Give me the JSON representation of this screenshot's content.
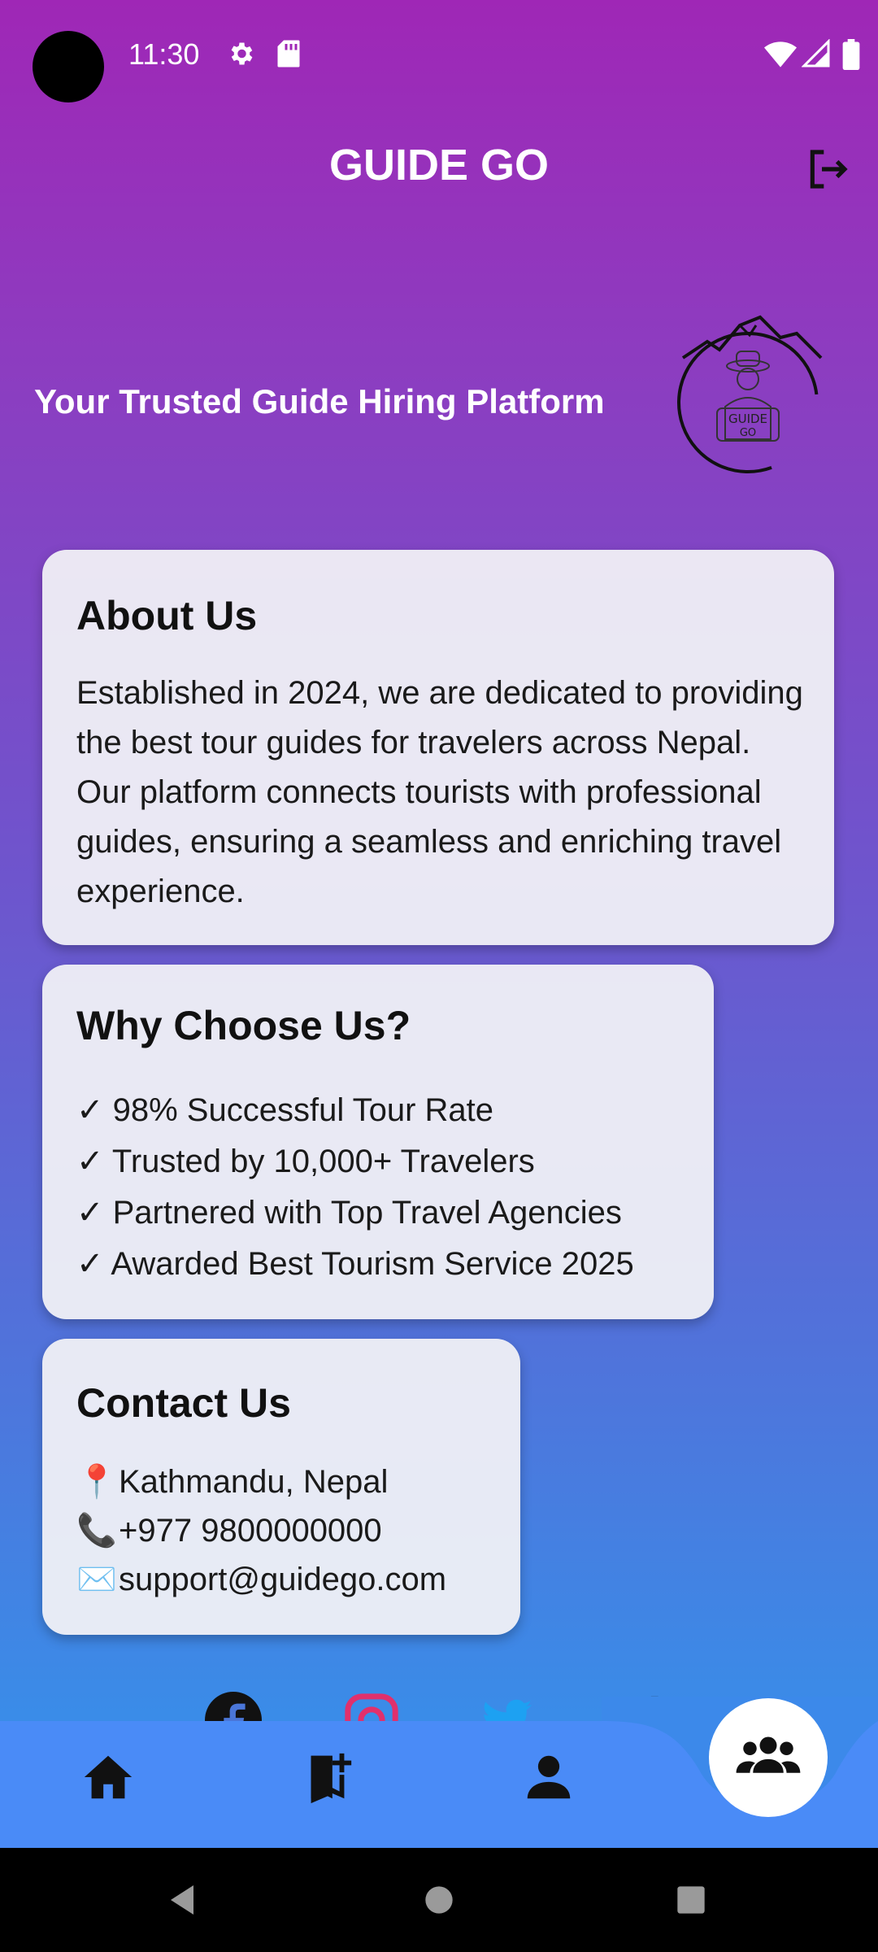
{
  "status": {
    "time": "11:30"
  },
  "header": {
    "title": "GUIDE GO"
  },
  "tagline": "Your Trusted Guide Hiring Platform",
  "logo_text": "GUIDE GO",
  "about": {
    "heading": "About Us",
    "body": "Established in 2024, we are dedicated to providing the best tour guides for travelers across Nepal. Our platform connects tourists with professional guides, ensuring a seamless and enriching travel experience."
  },
  "why": {
    "heading": "Why Choose Us?",
    "items": [
      "✓ 98% Successful Tour Rate",
      "✓ Trusted by 10,000+ Travelers",
      "✓ Partnered with Top Travel Agencies",
      "✓ Awarded Best Tourism Service 2025"
    ]
  },
  "contact": {
    "heading": "Contact Us",
    "location_icon": "📍",
    "location": "Kathmandu, Nepal",
    "phone_icon": "📞",
    "phone": "+977 9800000000",
    "email_icon": "✉️",
    "email": "support@guidego.com"
  },
  "nav": {
    "items": [
      "home-icon",
      "bookmark-add-icon",
      "person-icon",
      "group-icon"
    ],
    "active": "group-icon"
  },
  "colors": {
    "gradient_top": "#9f27b6",
    "gradient_bottom": "#3f8cf4",
    "navbar": "#4a8bf7"
  }
}
